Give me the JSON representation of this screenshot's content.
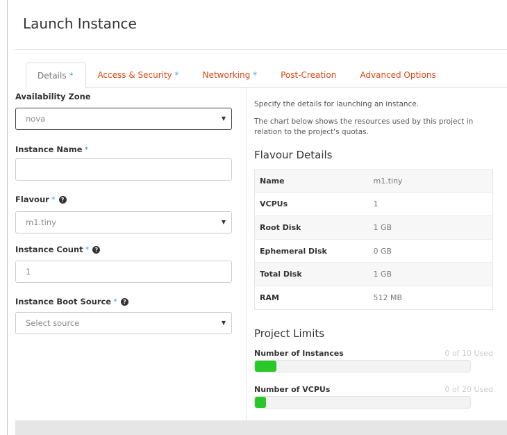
{
  "modal": {
    "title": "Launch Instance"
  },
  "tabs": [
    {
      "label": "Details",
      "required_mark": "*"
    },
    {
      "label": "Access & Security",
      "required_mark": "*"
    },
    {
      "label": "Networking",
      "required_mark": "*"
    },
    {
      "label": "Post-Creation",
      "required_mark": ""
    },
    {
      "label": "Advanced Options",
      "required_mark": ""
    }
  ],
  "form": {
    "availability_zone": {
      "label": "Availability Zone",
      "value": "nova"
    },
    "instance_name": {
      "label": "Instance Name",
      "required_mark": "*",
      "value": ""
    },
    "flavour": {
      "label": "Flavour",
      "required_mark": "*",
      "value": "m1.tiny"
    },
    "instance_count": {
      "label": "Instance Count",
      "required_mark": "*",
      "value": "1"
    },
    "boot_source": {
      "label": "Instance Boot Source",
      "required_mark": "*",
      "value": "Select source"
    },
    "help_glyph": "?",
    "caret_glyph": "▼"
  },
  "info": {
    "intro": "Specify the details for launching an instance.",
    "quota_text": "The chart below shows the resources used by this project in relation to the project's quotas.",
    "flavour_title": "Flavour Details",
    "flavour_details": [
      {
        "key": "Name",
        "value": "m1.tiny"
      },
      {
        "key": "VCPUs",
        "value": "1"
      },
      {
        "key": "Root Disk",
        "value": "1 GB"
      },
      {
        "key": "Ephemeral Disk",
        "value": "0 GB"
      },
      {
        "key": "Total Disk",
        "value": "1 GB"
      },
      {
        "key": "RAM",
        "value": "512 MB"
      }
    ],
    "limits_title": "Project Limits",
    "limits": [
      {
        "label": "Number of Instances",
        "used_text": "0 of 10 Used",
        "fill_fraction": 0.1
      },
      {
        "label": "Number of VCPUs",
        "used_text": "0 of 20 Used",
        "fill_fraction": 0.05
      }
    ]
  },
  "colors": {
    "accent": "#dd4814",
    "required": "#4aa3df",
    "bar_fill": "#28c828",
    "footer": "#e6e6e6"
  }
}
